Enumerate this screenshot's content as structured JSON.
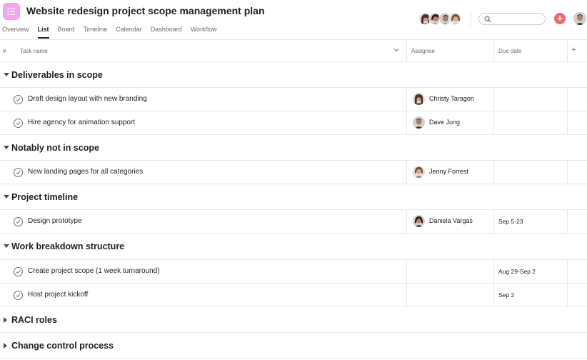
{
  "project": {
    "title": "Website redesign project scope management plan",
    "icon": "list-icon"
  },
  "tabs": [
    {
      "label": "Overview",
      "active": false
    },
    {
      "label": "List",
      "active": true
    },
    {
      "label": "Board",
      "active": false
    },
    {
      "label": "Timeline",
      "active": false
    },
    {
      "label": "Calendar",
      "active": false
    },
    {
      "label": "Dashboard",
      "active": false
    },
    {
      "label": "Workflow",
      "active": false
    }
  ],
  "toolbar": {
    "search_placeholder": "",
    "add_label": "+"
  },
  "columns": {
    "hash": "#",
    "task_name": "Task name",
    "assignee": "Assignee",
    "due_date": "Due date",
    "add": "+"
  },
  "sections": [
    {
      "title": "Deliverables in scope",
      "expanded": true,
      "tasks": [
        {
          "name": "Draft design layout with new branding",
          "assignee": "Christy Taragon",
          "due": ""
        },
        {
          "name": "Hire agency for animation support",
          "assignee": "Dave Jung",
          "due": ""
        }
      ]
    },
    {
      "title": "Notably not in scope",
      "expanded": true,
      "tasks": [
        {
          "name": "New landing pages for all categories",
          "assignee": "Jenny Forrest",
          "due": ""
        }
      ]
    },
    {
      "title": "Project timeline",
      "expanded": true,
      "tasks": [
        {
          "name": "Design prototype",
          "assignee": "Daniela Vargas",
          "due": "Sep 5-23"
        }
      ]
    },
    {
      "title": "Work breakdown structure",
      "expanded": true,
      "tasks": [
        {
          "name": "Create project scope (1 week turnaround)",
          "assignee": "",
          "due": "Aug 29-Sep 2"
        },
        {
          "name": "Host project kickoff",
          "assignee": "",
          "due": "Sep 2"
        }
      ]
    },
    {
      "title": "RACI roles",
      "expanded": false,
      "tasks": []
    },
    {
      "title": "Change control process",
      "expanded": false,
      "tasks": []
    }
  ],
  "colors": {
    "accent": "#f06a6a",
    "app_icon": "#f1a6f0",
    "border": "#e8e8e8"
  }
}
